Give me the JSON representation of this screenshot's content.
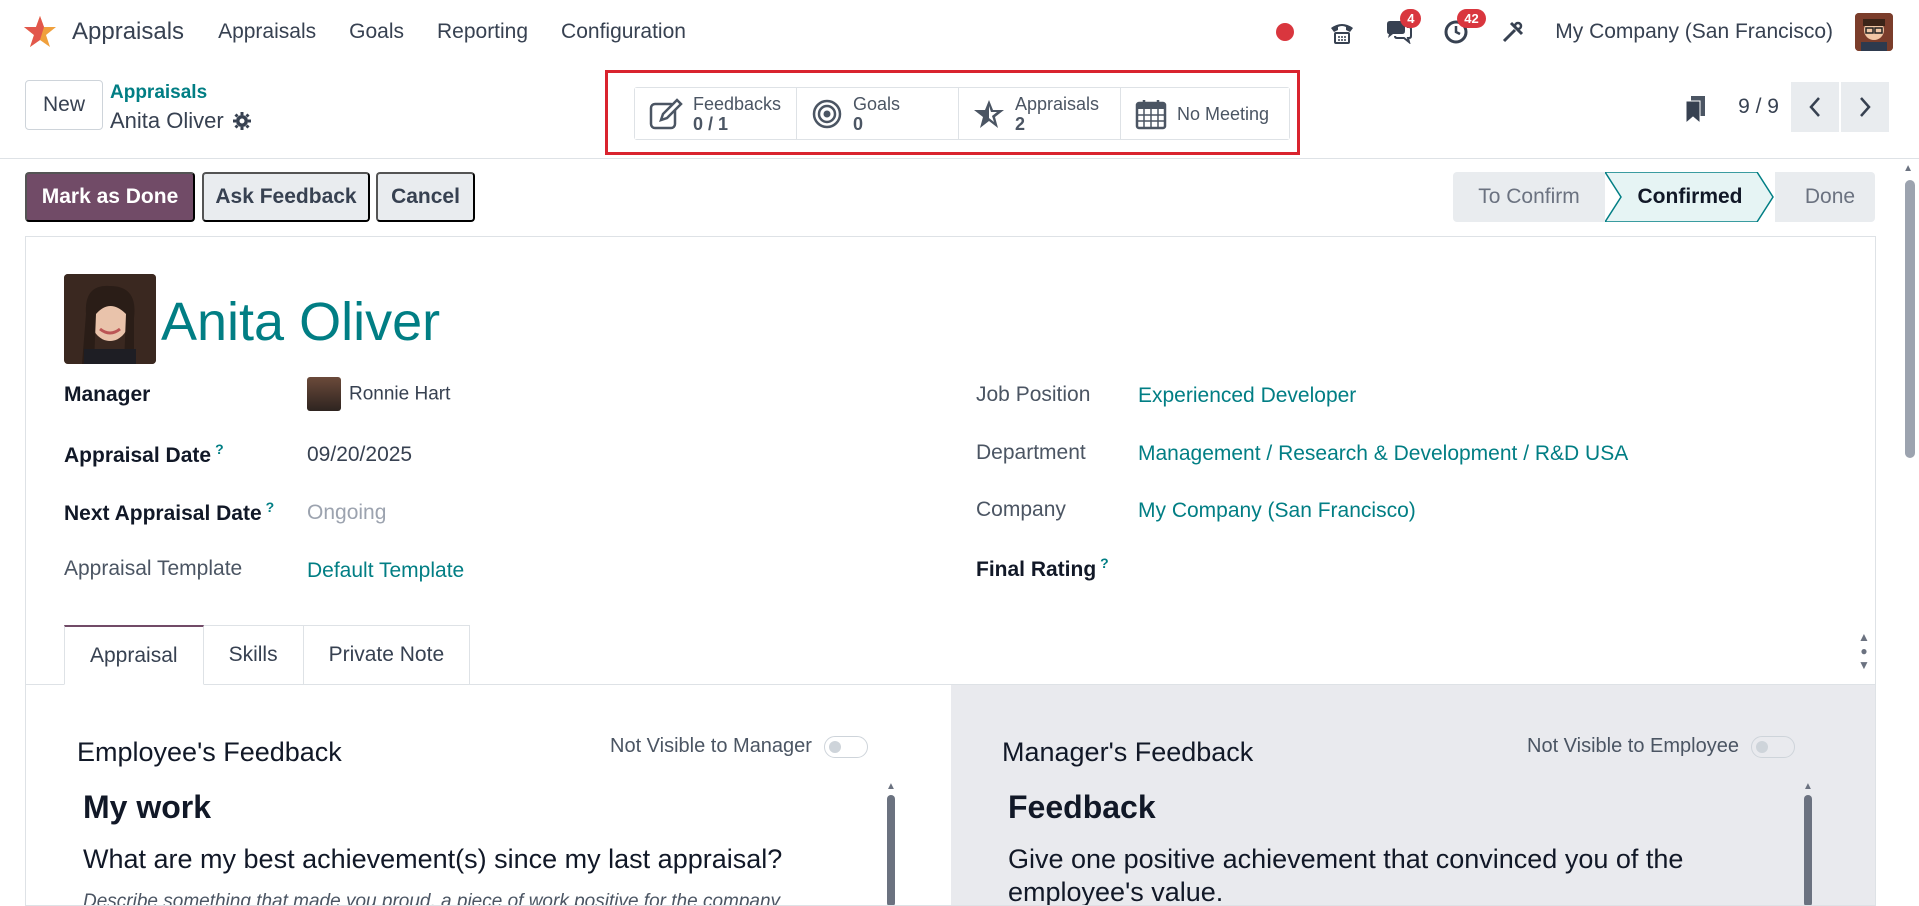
{
  "navbar": {
    "app_name": "Appraisals",
    "menu": [
      "Appraisals",
      "Goals",
      "Reporting",
      "Configuration"
    ],
    "messages_count": "4",
    "activities_count": "42",
    "company": "My Company (San Francisco)"
  },
  "breadcrumb": {
    "new_label": "New",
    "parent": "Appraisals",
    "current": "Anita Oliver"
  },
  "smart_buttons": [
    {
      "label": "Feedbacks",
      "value": "0 / 1",
      "icon": "feedback-edit-icon"
    },
    {
      "label": "Goals",
      "value": "0",
      "icon": "target-icon"
    },
    {
      "label": "Appraisals",
      "value": "2",
      "icon": "star-icon"
    },
    {
      "label": "No Meeting",
      "value": "",
      "icon": "calendar-icon"
    }
  ],
  "pager": {
    "count": "9 / 9"
  },
  "actions": {
    "mark_done": "Mark as Done",
    "ask_feedback": "Ask Feedback",
    "cancel": "Cancel"
  },
  "stages": [
    "To Confirm",
    "Confirmed",
    "Done"
  ],
  "active_stage": "Confirmed",
  "employee": {
    "name": "Anita Oliver",
    "manager_label": "Manager",
    "manager": "Ronnie Hart",
    "appraisal_date_label": "Appraisal Date",
    "appraisal_date": "09/20/2025",
    "next_date_label": "Next Appraisal Date",
    "next_date": "Ongoing",
    "template_label": "Appraisal Template",
    "template": "Default Template",
    "job_label": "Job Position",
    "job": "Experienced Developer",
    "department_label": "Department",
    "department": "Management / Research & Development / R&D USA",
    "company_label": "Company",
    "company": "My Company (San Francisco)",
    "rating_label": "Final Rating",
    "help_mark": "?"
  },
  "tabs": [
    "Appraisal",
    "Skills",
    "Private Note"
  ],
  "employee_feedback": {
    "title": "Employee's Feedback",
    "toggle_label": "Not Visible to Manager",
    "heading": "My work",
    "question": "What are my best achievement(s) since my last appraisal?",
    "hint": "Describe something that made you proud, a piece of work positive for the company"
  },
  "manager_feedback": {
    "title": "Manager's Feedback",
    "toggle_label": "Not Visible to Employee",
    "heading": "Feedback",
    "question_line1": "Give one positive achievement that convinced you of the",
    "question_line2": "employee's value."
  },
  "colors": {
    "accent": "#714b67",
    "link": "#017e84",
    "badge": "#d9363e",
    "highlight_box": "#d9232e"
  }
}
